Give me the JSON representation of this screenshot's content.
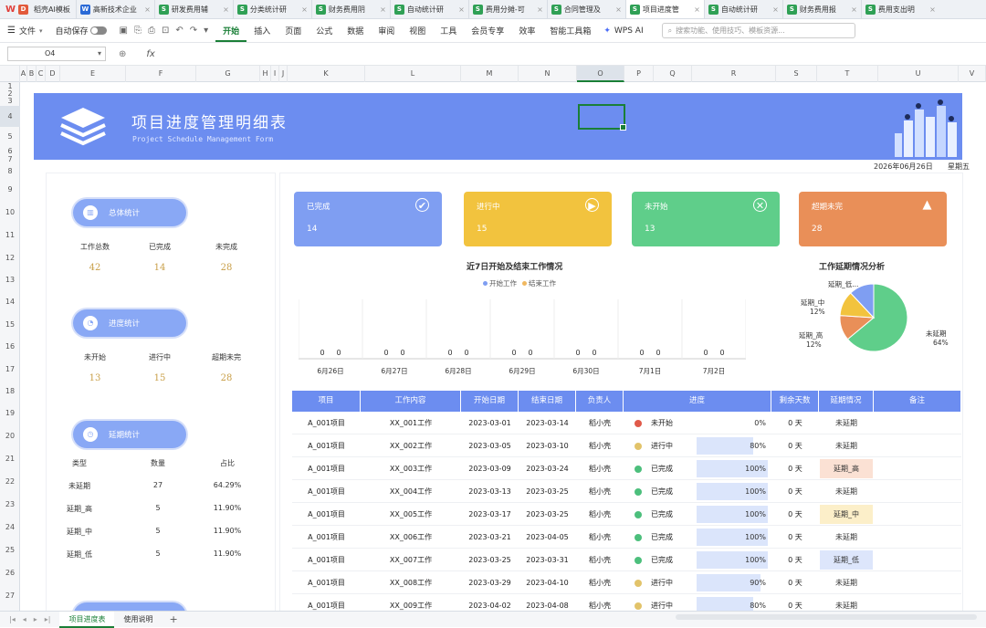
{
  "tabs": {
    "app_label": "稻壳AI模板",
    "items": [
      {
        "icon": "w",
        "label": "高新技术企业"
      },
      {
        "icon": "s",
        "label": "研发费用辅"
      },
      {
        "icon": "s",
        "label": "分类统计研"
      },
      {
        "icon": "s",
        "label": "财务费用阴"
      },
      {
        "icon": "s",
        "label": "自动统计研"
      },
      {
        "icon": "s",
        "label": "费用分摊-可"
      },
      {
        "icon": "s",
        "label": "合同管理及"
      },
      {
        "icon": "s",
        "label": "项目进度管"
      },
      {
        "icon": "s",
        "label": "自动统计研"
      },
      {
        "icon": "s",
        "label": "财务费用报"
      },
      {
        "icon": "s",
        "label": "费用支出明"
      }
    ],
    "active_index": 7
  },
  "menu": {
    "file": "文件",
    "autosave": "自动保存",
    "items": [
      "开始",
      "插入",
      "页面",
      "公式",
      "数据",
      "审阅",
      "视图",
      "工具",
      "会员专享",
      "效率",
      "智能工具箱"
    ],
    "active": "开始",
    "wps_ai": "WPS AI",
    "search_placeholder": "搜索功能、使用技巧、模板资源..."
  },
  "formula_bar": {
    "cell_ref": "O4",
    "fx": "fx",
    "content": ""
  },
  "columns": [
    "A",
    "B",
    "C",
    "D",
    "E",
    "F",
    "G",
    "H",
    "I",
    "J",
    "K",
    "L",
    "M",
    "N",
    "O",
    "P",
    "Q",
    "R",
    "S",
    "T",
    "U",
    "V"
  ],
  "rows": [
    "1",
    "2",
    "3",
    "4",
    "5",
    "6",
    "7",
    "8",
    "9",
    "10",
    "11",
    "12",
    "13",
    "14",
    "15",
    "16",
    "17",
    "18",
    "19",
    "20",
    "21",
    "22",
    "23",
    "24",
    "25",
    "26",
    "27"
  ],
  "selected_cell": {
    "column": "O",
    "row": "4"
  },
  "banner": {
    "title": "项目进度管理明细表",
    "subtitle": "Project Schedule Management Form"
  },
  "date": "2026年06月26日",
  "weekday": "星期五",
  "summary": {
    "label": "总体统计",
    "stats": [
      {
        "label": "工作总数",
        "value": "42"
      },
      {
        "label": "已完成",
        "value": "14"
      },
      {
        "label": "未完成",
        "value": "28"
      }
    ]
  },
  "progress_stats": {
    "label": "进度统计",
    "stats": [
      {
        "label": "未开始",
        "value": "13"
      },
      {
        "label": "进行中",
        "value": "15"
      },
      {
        "label": "超期未完",
        "value": "28"
      }
    ]
  },
  "delay_stats": {
    "label": "延期统计",
    "headers": [
      "类型",
      "数量",
      "占比"
    ],
    "rows": [
      {
        "type": "未延期",
        "count": "27",
        "pct": "64.29%"
      },
      {
        "type": "延期_高",
        "count": "5",
        "pct": "11.90%"
      },
      {
        "type": "延期_中",
        "count": "5",
        "pct": "11.90%"
      },
      {
        "type": "延期_低",
        "count": "5",
        "pct": "11.90%"
      }
    ]
  },
  "cards": [
    {
      "label": "已完成",
      "value": "14",
      "color": "#7f9ef2",
      "icon": "check-circle-icon"
    },
    {
      "label": "进行中",
      "value": "15",
      "color": "#f2c33e",
      "icon": "play-circle-icon"
    },
    {
      "label": "未开始",
      "value": "13",
      "color": "#5fce8a",
      "icon": "x-oval-icon"
    },
    {
      "label": "超期未完",
      "value": "28",
      "color": "#e98f58",
      "icon": "warning-icon"
    }
  ],
  "chart_data": [
    {
      "type": "bar",
      "title": "近7日开始及结束工作情况",
      "categories": [
        "6月26日",
        "6月27日",
        "6月28日",
        "6月29日",
        "6月30日",
        "7月1日",
        "7月2日"
      ],
      "series": [
        {
          "name": "开始工作",
          "values": [
            0,
            0,
            0,
            0,
            0,
            0,
            0
          ],
          "color": "#7f9ef2"
        },
        {
          "name": "结束工作",
          "values": [
            0,
            0,
            0,
            0,
            0,
            0,
            0
          ],
          "color": "#f0b860"
        }
      ],
      "legend": "top"
    },
    {
      "type": "pie",
      "title": "工作延期情况分析",
      "slices": [
        {
          "label": "未延期",
          "value": 64,
          "pct_label": "64%",
          "color": "#5fce8a"
        },
        {
          "label": "延期_高",
          "value": 12,
          "pct_label": "12%",
          "color": "#e98f58"
        },
        {
          "label": "延期_中",
          "value": 12,
          "pct_label": "12%",
          "color": "#f2c33e"
        },
        {
          "label": "延期_低",
          "value": 12,
          "pct_label": "",
          "color": "#7f9ef2"
        }
      ],
      "slice_labels": {
        "low": "延期_低...",
        "mid": "延期_中",
        "high": "延期_高"
      }
    }
  ],
  "table": {
    "headers": [
      "项目",
      "工作内容",
      "开始日期",
      "结束日期",
      "负责人",
      "进度",
      "剩余天数",
      "延期情况",
      "备注"
    ],
    "rows": [
      {
        "project": "A_001项目",
        "task": "XX_001工作",
        "start": "2023-03-01",
        "end": "2023-03-14",
        "owner": "稻小壳",
        "status": "未开始",
        "status_color": "#e05a4a",
        "progress": "0%",
        "pct": 0,
        "remain": "0 天",
        "delay": "未延期",
        "delay_bg": ""
      },
      {
        "project": "A_001项目",
        "task": "XX_002工作",
        "start": "2023-03-05",
        "end": "2023-03-10",
        "owner": "稻小壳",
        "status": "进行中",
        "status_color": "#e2c36a",
        "progress": "80%",
        "pct": 80,
        "remain": "0 天",
        "delay": "未延期",
        "delay_bg": ""
      },
      {
        "project": "A_001项目",
        "task": "XX_003工作",
        "start": "2023-03-09",
        "end": "2023-03-24",
        "owner": "稻小壳",
        "status": "已完成",
        "status_color": "#4cbf7c",
        "progress": "100%",
        "pct": 100,
        "remain": "0 天",
        "delay": "延期_高",
        "delay_bg": "#fbe1d4"
      },
      {
        "project": "A_001项目",
        "task": "XX_004工作",
        "start": "2023-03-13",
        "end": "2023-03-25",
        "owner": "稻小壳",
        "status": "已完成",
        "status_color": "#4cbf7c",
        "progress": "100%",
        "pct": 100,
        "remain": "0 天",
        "delay": "未延期",
        "delay_bg": ""
      },
      {
        "project": "A_001项目",
        "task": "XX_005工作",
        "start": "2023-03-17",
        "end": "2023-03-25",
        "owner": "稻小壳",
        "status": "已完成",
        "status_color": "#4cbf7c",
        "progress": "100%",
        "pct": 100,
        "remain": "0 天",
        "delay": "延期_中",
        "delay_bg": "#fcefc9"
      },
      {
        "project": "A_001项目",
        "task": "XX_006工作",
        "start": "2023-03-21",
        "end": "2023-04-05",
        "owner": "稻小壳",
        "status": "已完成",
        "status_color": "#4cbf7c",
        "progress": "100%",
        "pct": 100,
        "remain": "0 天",
        "delay": "未延期",
        "delay_bg": ""
      },
      {
        "project": "A_001项目",
        "task": "XX_007工作",
        "start": "2023-03-25",
        "end": "2023-03-31",
        "owner": "稻小壳",
        "status": "已完成",
        "status_color": "#4cbf7c",
        "progress": "100%",
        "pct": 100,
        "remain": "0 天",
        "delay": "延期_低",
        "delay_bg": "#dde6fb"
      },
      {
        "project": "A_001项目",
        "task": "XX_008工作",
        "start": "2023-03-29",
        "end": "2023-04-10",
        "owner": "稻小壳",
        "status": "进行中",
        "status_color": "#e2c36a",
        "progress": "90%",
        "pct": 90,
        "remain": "0 天",
        "delay": "未延期",
        "delay_bg": ""
      },
      {
        "project": "A_001项目",
        "task": "XX_009工作",
        "start": "2023-04-02",
        "end": "2023-04-08",
        "owner": "稻小壳",
        "status": "进行中",
        "status_color": "#e2c36a",
        "progress": "80%",
        "pct": 80,
        "remain": "0 天",
        "delay": "未延期",
        "delay_bg": ""
      }
    ]
  },
  "sheets": {
    "tabs": [
      "项目进度表",
      "使用说明"
    ],
    "active": 0,
    "add": "+"
  }
}
